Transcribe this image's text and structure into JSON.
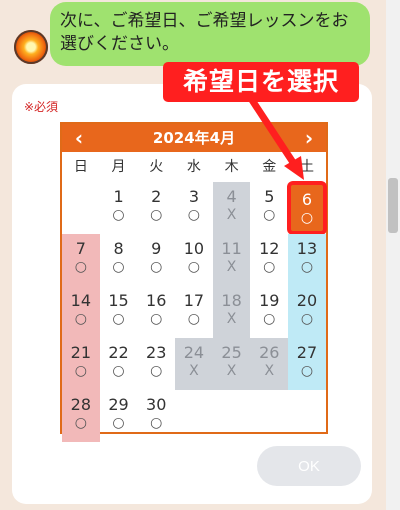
{
  "chat": {
    "message": "次に、ご希望日、ご希望レッスンをお選びください。"
  },
  "form": {
    "required_label": "※必須",
    "callout_label": "希望日を選択",
    "ok_label": "OK"
  },
  "calendar": {
    "title": "2024年4月",
    "prev_icon": "‹",
    "next_icon": "›",
    "weekdays": [
      "日",
      "月",
      "火",
      "水",
      "木",
      "金",
      "土"
    ],
    "selected_day": 6,
    "weeks": [
      [
        {
          "day": "",
          "mark": "",
          "state": "empty"
        },
        {
          "day": "1",
          "mark": "○",
          "state": "available"
        },
        {
          "day": "2",
          "mark": "○",
          "state": "available"
        },
        {
          "day": "3",
          "mark": "○",
          "state": "available"
        },
        {
          "day": "4",
          "mark": "X",
          "state": "unavailable"
        },
        {
          "day": "5",
          "mark": "○",
          "state": "available"
        },
        {
          "day": "6",
          "mark": "○",
          "state": "selected"
        }
      ],
      [
        {
          "day": "7",
          "mark": "○",
          "state": "sun"
        },
        {
          "day": "8",
          "mark": "○",
          "state": "available"
        },
        {
          "day": "9",
          "mark": "○",
          "state": "available"
        },
        {
          "day": "10",
          "mark": "○",
          "state": "available"
        },
        {
          "day": "11",
          "mark": "X",
          "state": "unavailable"
        },
        {
          "day": "12",
          "mark": "○",
          "state": "available"
        },
        {
          "day": "13",
          "mark": "○",
          "state": "sat"
        }
      ],
      [
        {
          "day": "14",
          "mark": "○",
          "state": "sun"
        },
        {
          "day": "15",
          "mark": "○",
          "state": "available"
        },
        {
          "day": "16",
          "mark": "○",
          "state": "available"
        },
        {
          "day": "17",
          "mark": "○",
          "state": "available"
        },
        {
          "day": "18",
          "mark": "X",
          "state": "unavailable"
        },
        {
          "day": "19",
          "mark": "○",
          "state": "available"
        },
        {
          "day": "20",
          "mark": "○",
          "state": "sat"
        }
      ],
      [
        {
          "day": "21",
          "mark": "○",
          "state": "sun"
        },
        {
          "day": "22",
          "mark": "○",
          "state": "available"
        },
        {
          "day": "23",
          "mark": "○",
          "state": "available"
        },
        {
          "day": "24",
          "mark": "X",
          "state": "unavailable"
        },
        {
          "day": "25",
          "mark": "X",
          "state": "unavailable"
        },
        {
          "day": "26",
          "mark": "X",
          "state": "unavailable"
        },
        {
          "day": "27",
          "mark": "○",
          "state": "sat"
        }
      ],
      [
        {
          "day": "28",
          "mark": "○",
          "state": "sun"
        },
        {
          "day": "29",
          "mark": "○",
          "state": "available"
        },
        {
          "day": "30",
          "mark": "○",
          "state": "available"
        },
        {
          "day": "",
          "mark": "",
          "state": "empty"
        },
        {
          "day": "",
          "mark": "",
          "state": "empty"
        },
        {
          "day": "",
          "mark": "",
          "state": "empty"
        },
        {
          "day": "",
          "mark": "",
          "state": "empty"
        }
      ]
    ]
  },
  "colors": {
    "accent": "#e8671c",
    "callout": "#ff1f1f",
    "chat_bubble": "#9fe26f",
    "sunday": "#f2b9b9",
    "saturday": "#bfeaf6",
    "unavailable": "#cfd3d9"
  }
}
